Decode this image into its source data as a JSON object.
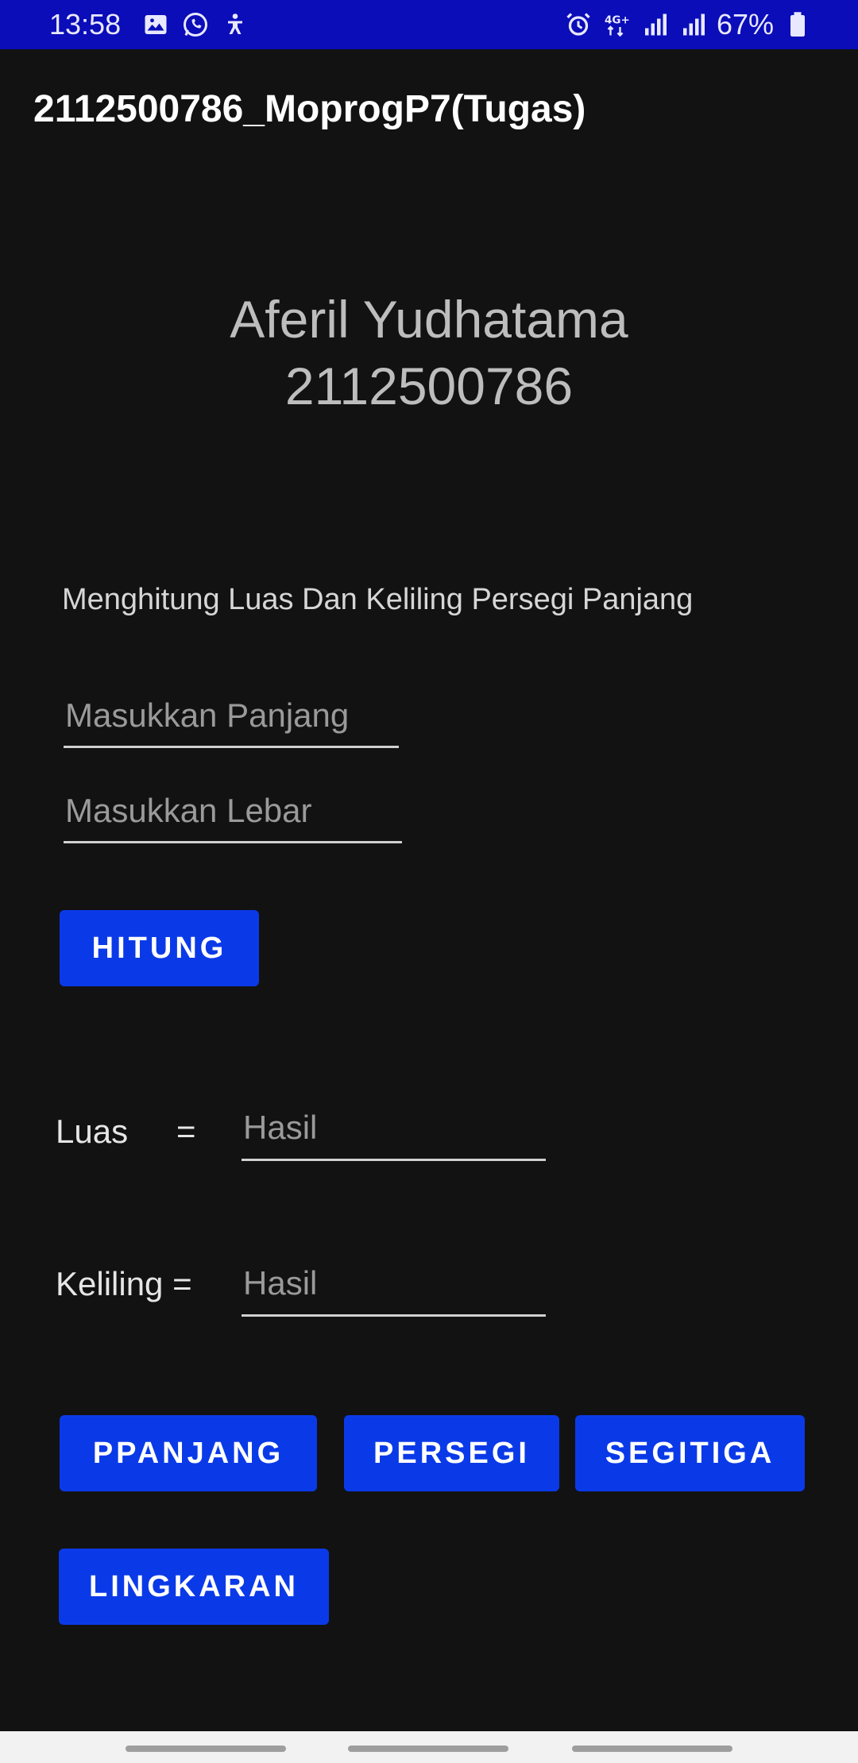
{
  "status_bar": {
    "time": "13:58",
    "battery_percent": "67%",
    "icons_left": [
      "gallery-icon",
      "whatsapp-icon",
      "accessibility-icon"
    ],
    "icons_right": [
      "alarm-icon",
      "4g-data-icon",
      "signal-icon",
      "signal-icon",
      "battery-icon"
    ]
  },
  "app_bar": {
    "title": "2112500786_MoprogP7(Tugas)"
  },
  "header": {
    "name": "Aferil Yudhatama",
    "nim": "2112500786"
  },
  "form": {
    "subtitle": "Menghitung Luas Dan Keliling Persegi Panjang",
    "panjang_placeholder": "Masukkan Panjang",
    "lebar_placeholder": "Masukkan Lebar",
    "hitung_label": "HITUNG"
  },
  "results": {
    "luas_label": "Luas",
    "equals": "=",
    "keliling_label": "Keliling =",
    "hasil_placeholder": "Hasil"
  },
  "nav_buttons": {
    "ppanjang": "PPANJANG",
    "persegi": "PERSEGI",
    "segitiga": "SEGITIGA",
    "lingkaran": "LINGKARAN"
  },
  "colors": {
    "status_bar": "#0a0db8",
    "background": "#121212",
    "button": "#0a3ae8"
  }
}
